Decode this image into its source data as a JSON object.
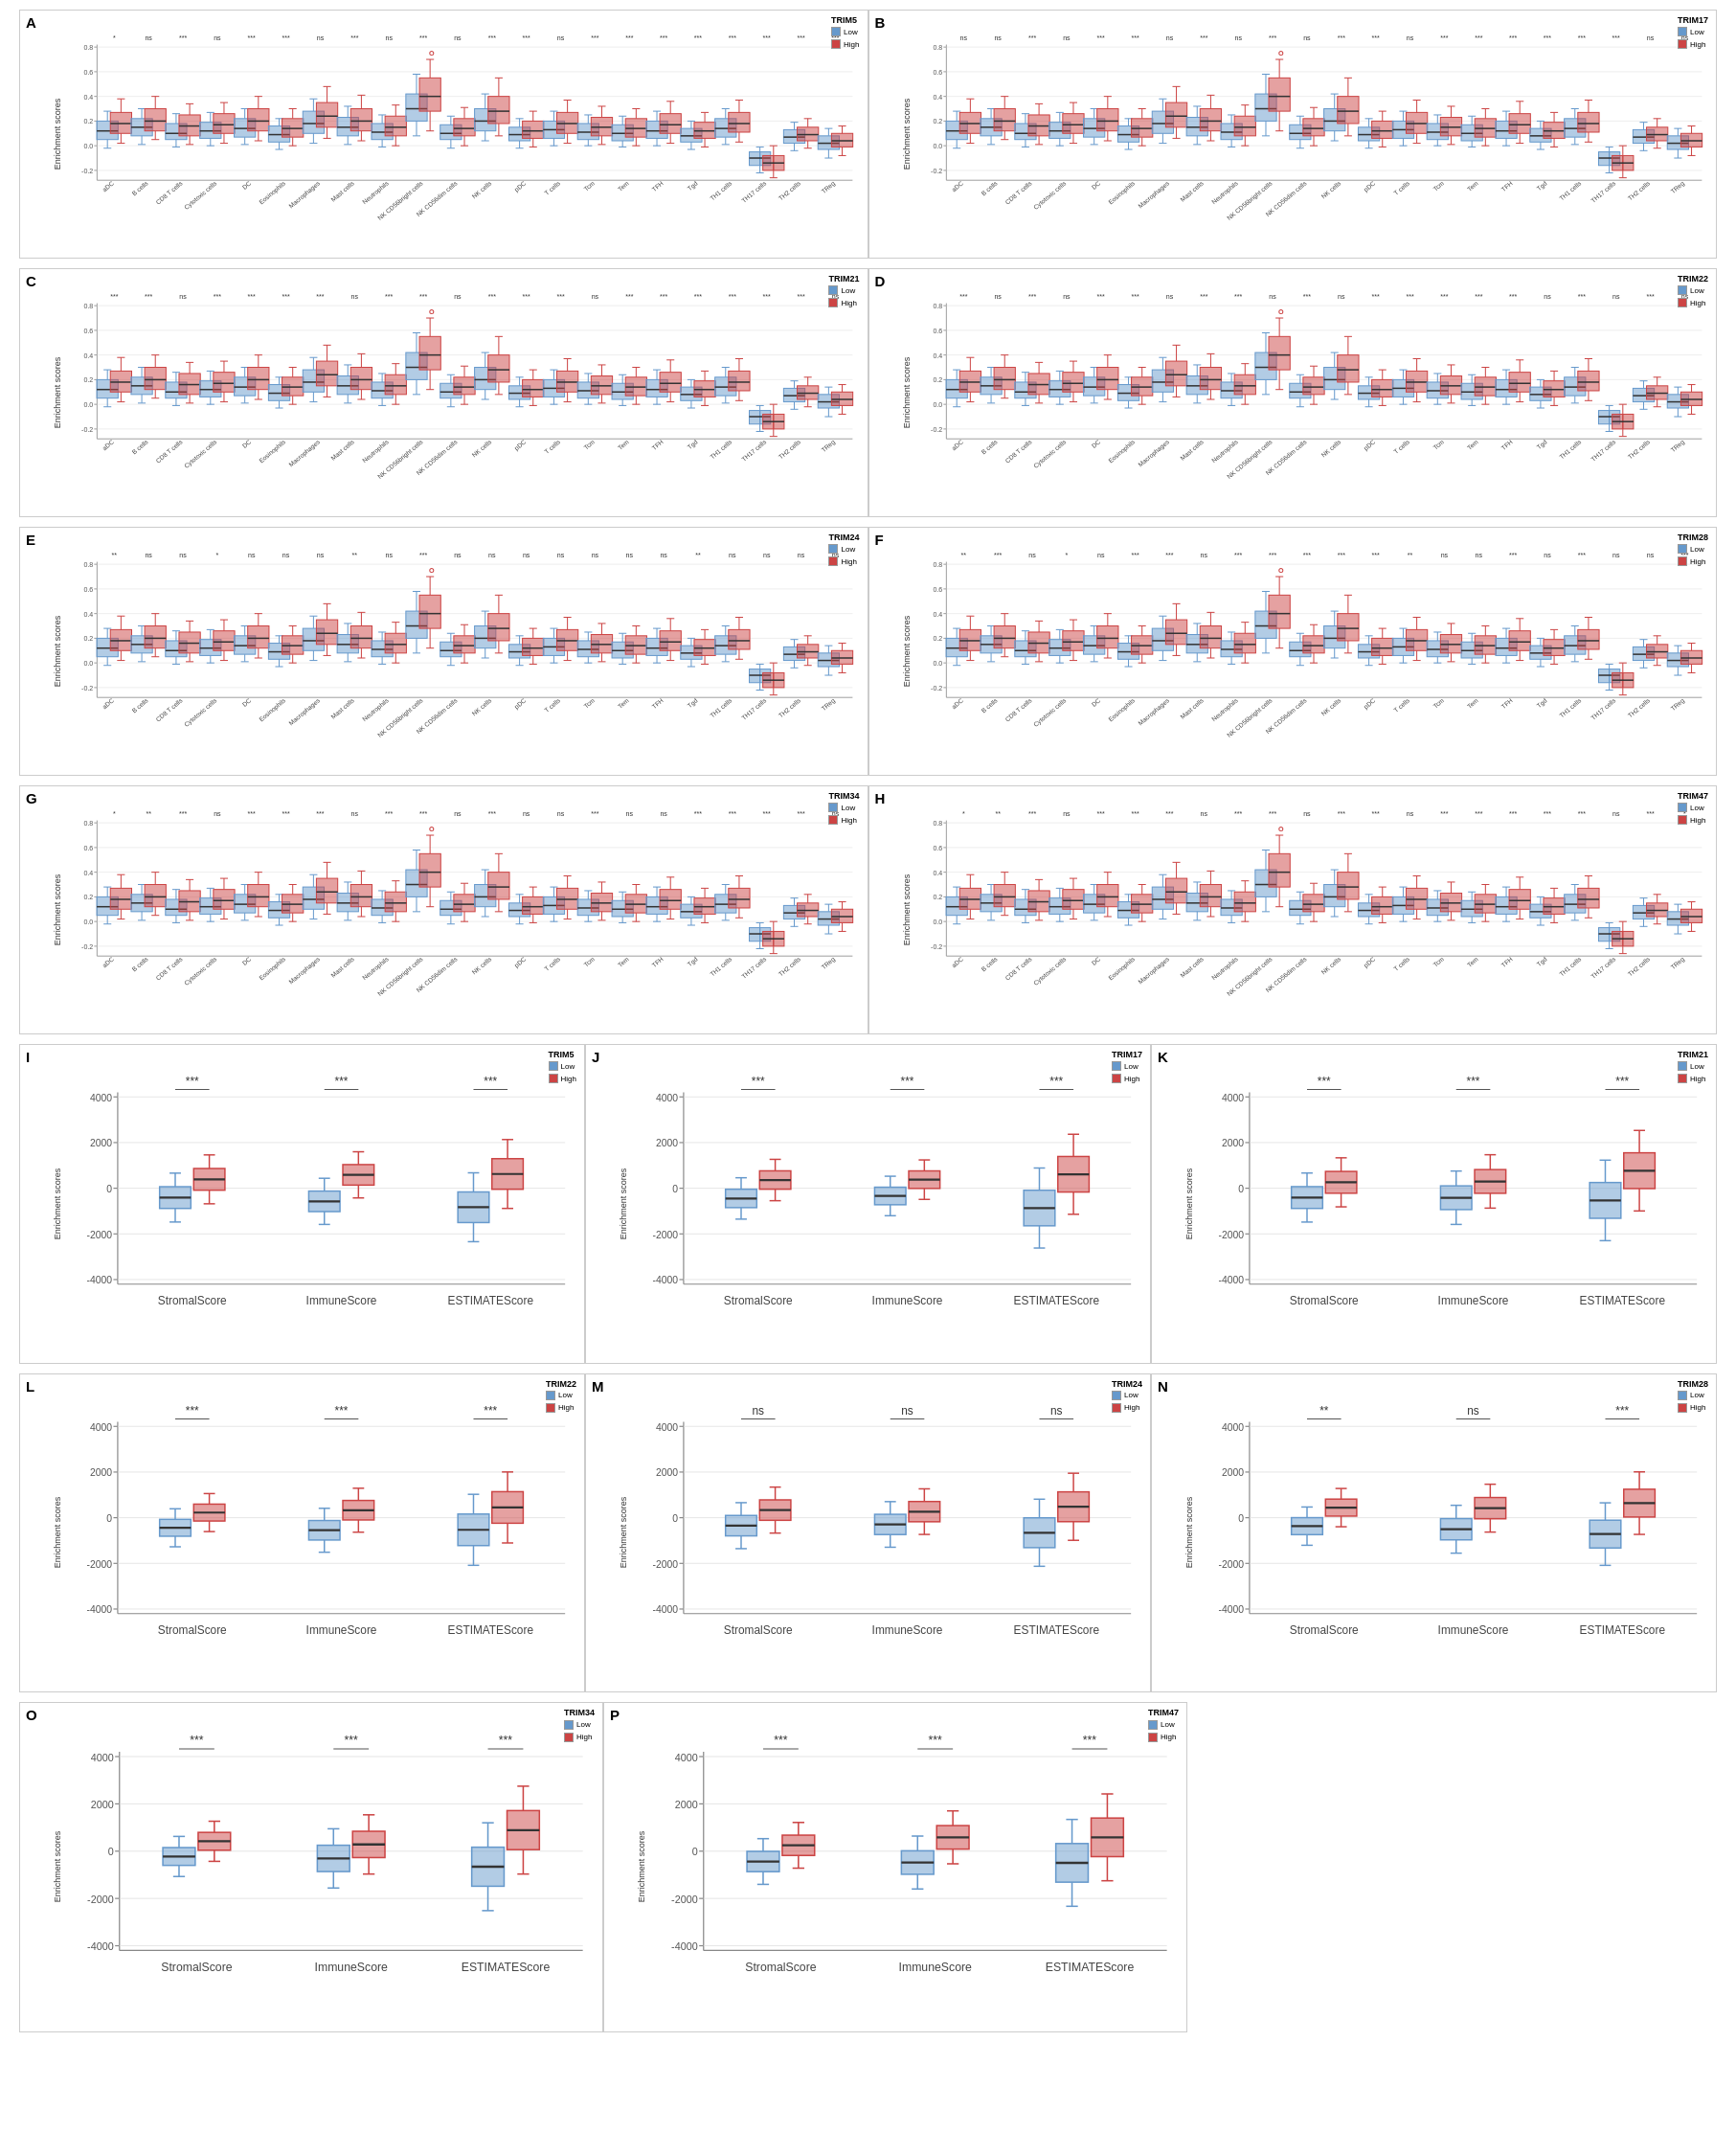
{
  "colors": {
    "low": "#6699cc",
    "high": "#cc4444",
    "axis": "#333",
    "box_stroke": "#555"
  },
  "xLabels": [
    "aDC",
    "B cells",
    "CD8 T cells",
    "Cytotoxic cells",
    "DC",
    "Eosinophils",
    "Macrophages",
    "Mast cells",
    "Neutrophils",
    "NK CD56bright cells",
    "NK CD56dim cells",
    "NK cells",
    "pDC",
    "T cells",
    "Tcm",
    "Tem",
    "TFH",
    "Tgd",
    "TH1 cells",
    "TH17 cells",
    "TH2 cells",
    "TReg"
  ],
  "xLabels3col": [
    "StromalScore",
    "ImmuneScore",
    "ESTIMATEScore"
  ],
  "panels": [
    {
      "id": "A",
      "trim": "TRIM5",
      "sig": [
        "*",
        "ns",
        "***",
        "ns",
        "***",
        "***",
        "ns",
        "***",
        "ns",
        "***",
        "ns",
        "***",
        "***",
        "ns",
        "***",
        "***",
        "***",
        "***",
        "***",
        "***",
        "***",
        "***"
      ]
    },
    {
      "id": "B",
      "trim": "TRIM17",
      "sig": [
        "ns",
        "ns",
        "***",
        "ns",
        "***",
        "***",
        "ns",
        "***",
        "ns",
        "***",
        "ns",
        "***",
        "***",
        "ns",
        "***",
        "***",
        "***",
        "***",
        "***",
        "***",
        "ns",
        "ns"
      ]
    },
    {
      "id": "C",
      "trim": "TRIM21",
      "sig": [
        "***",
        "***",
        "ns",
        "***",
        "***",
        "***",
        "***",
        "ns",
        "***",
        "***",
        "ns",
        "***",
        "***",
        "***",
        "ns",
        "***",
        "***",
        "***",
        "***",
        "***",
        "***",
        "ns"
      ]
    },
    {
      "id": "D",
      "trim": "TRIM22",
      "sig": [
        "***",
        "ns",
        "***",
        "ns",
        "***",
        "***",
        "ns",
        "***",
        "***",
        "ns",
        "***",
        "ns",
        "***",
        "***",
        "***",
        "***",
        "***",
        "ns",
        "***",
        "ns",
        "***",
        "ns"
      ]
    },
    {
      "id": "E",
      "trim": "TRIM24",
      "sig": [
        "**",
        "ns",
        "ns",
        "*",
        "ns",
        "ns",
        "ns",
        "**",
        "ns",
        "***",
        "ns",
        "ns",
        "ns",
        "ns",
        "ns",
        "ns",
        "ns",
        "**",
        "ns",
        "ns",
        "ns",
        "ns"
      ]
    },
    {
      "id": "F",
      "trim": "TRIM28",
      "sig": [
        "**",
        "***",
        "ns",
        "*",
        "ns",
        "***",
        "***",
        "ns",
        "***",
        "***",
        "***",
        "***",
        "***",
        "**",
        "ns",
        "ns",
        "***",
        "ns",
        "***",
        "ns",
        "ns",
        "***"
      ]
    },
    {
      "id": "G",
      "trim": "TRIM34",
      "sig": [
        "*",
        "**",
        "***",
        "ns",
        "***",
        "***",
        "***",
        "ns",
        "***",
        "***",
        "ns",
        "***",
        "ns",
        "ns",
        "***",
        "ns",
        "ns",
        "***",
        "***",
        "***",
        "***",
        "ns"
      ]
    },
    {
      "id": "H",
      "trim": "TRIM47",
      "sig": [
        "*",
        "**",
        "***",
        "ns",
        "***",
        "***",
        "***",
        "ns",
        "***",
        "***",
        "ns",
        "***",
        "***",
        "ns",
        "***",
        "***",
        "***",
        "***",
        "***",
        "ns",
        "***",
        "*"
      ]
    }
  ],
  "panels3col": [
    {
      "id": "I",
      "trim": "TRIM5",
      "sig": [
        "***",
        "***",
        "***"
      ]
    },
    {
      "id": "J",
      "trim": "TRIM17",
      "sig": [
        "***",
        "***",
        "***"
      ]
    },
    {
      "id": "K",
      "trim": "TRIM21",
      "sig": [
        "***",
        "***",
        "***"
      ]
    },
    {
      "id": "L",
      "trim": "TRIM22",
      "sig": [
        "***",
        "***",
        "***"
      ]
    },
    {
      "id": "M",
      "trim": "TRIM24",
      "sig": [
        "ns",
        "ns",
        "ns"
      ]
    },
    {
      "id": "N",
      "trim": "TRIM28",
      "sig": [
        "**",
        "ns",
        "***"
      ]
    },
    {
      "id": "O",
      "trim": "TRIM34",
      "sig": [
        "***",
        "***",
        "***"
      ]
    },
    {
      "id": "P",
      "trim": "TRIM47",
      "sig": [
        "***",
        "***",
        "***"
      ]
    }
  ],
  "ui": {
    "yAxisLabel": "Enrichment scores",
    "legendLow": "Low",
    "legendHigh": "High"
  }
}
